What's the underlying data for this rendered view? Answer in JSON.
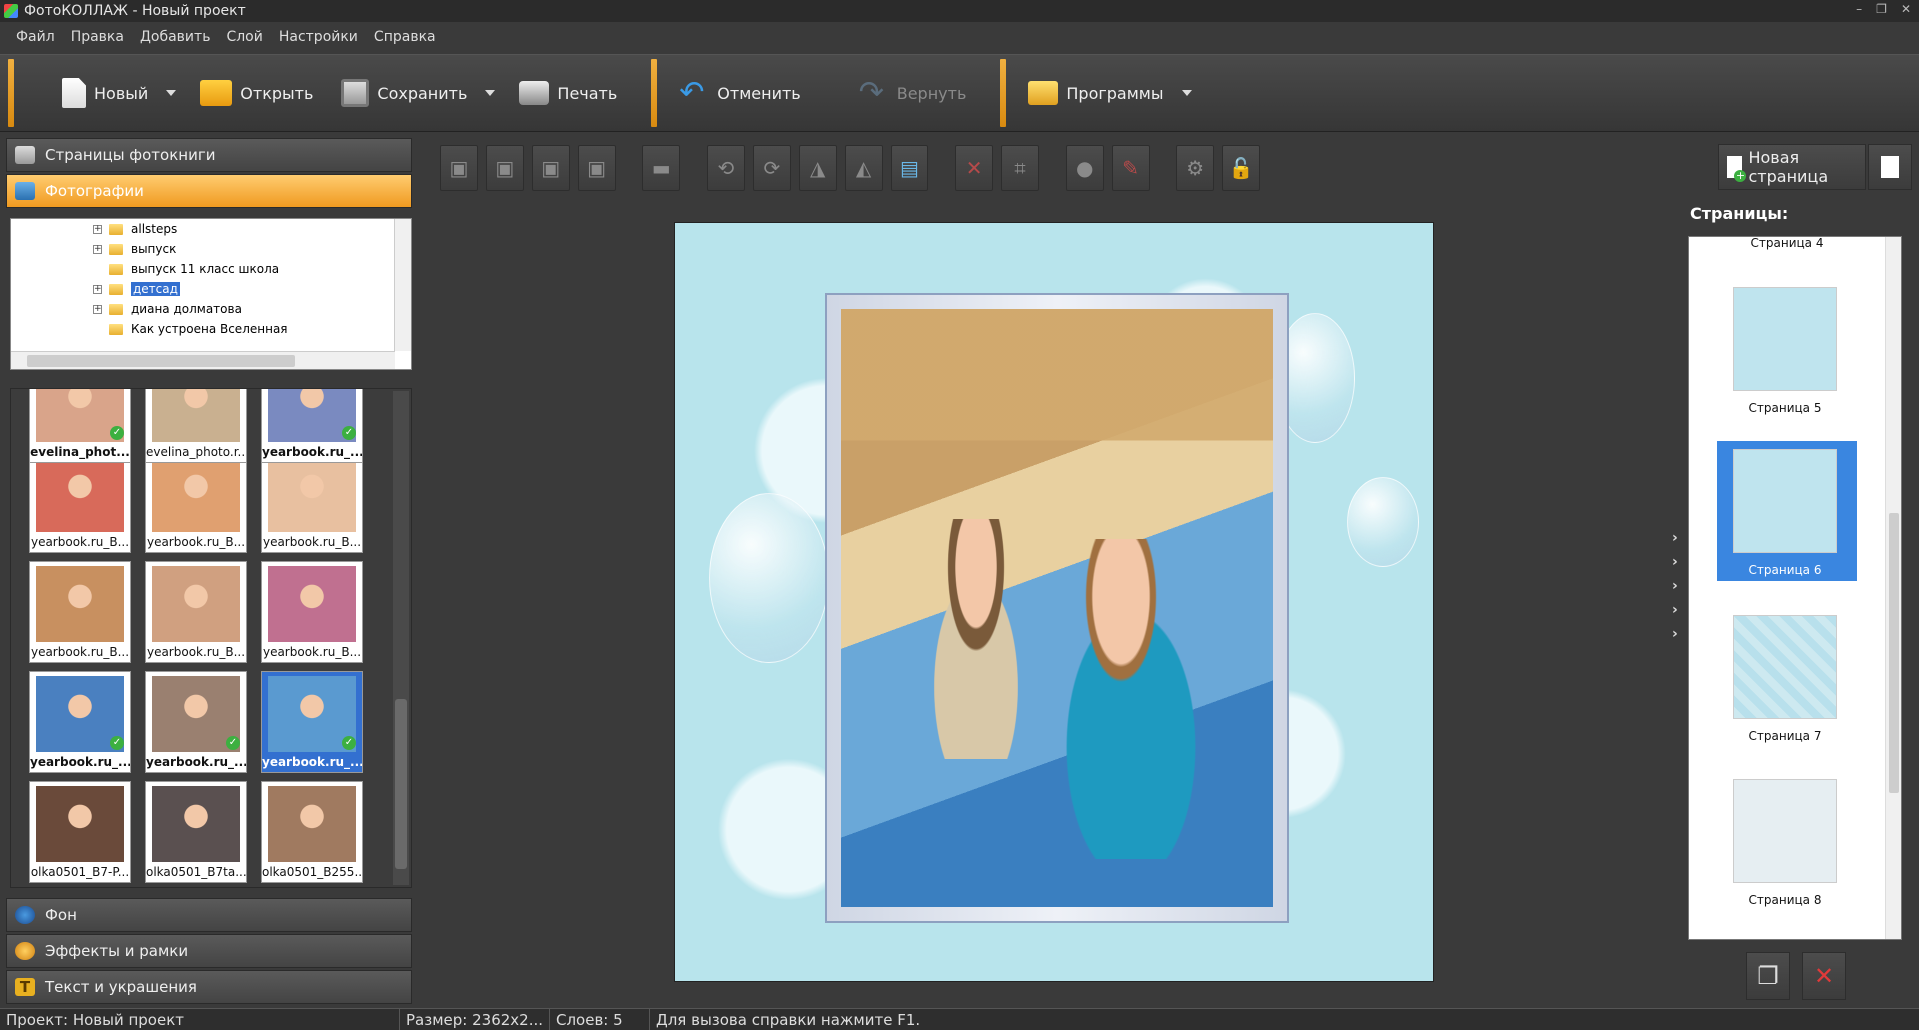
{
  "window": {
    "title": "ФотоКОЛЛАЖ - Новый проект"
  },
  "menu": [
    "Файл",
    "Правка",
    "Добавить",
    "Слой",
    "Настройки",
    "Справка"
  ],
  "toolbar": {
    "new_label": "Новый",
    "open_label": "Открыть",
    "save_label": "Сохранить",
    "print_label": "Печать",
    "undo_label": "Отменить",
    "redo_label": "Вернуть",
    "programs_label": "Программы"
  },
  "left_panel": {
    "book_pages": "Страницы фотокниги",
    "photos": "Фотографии",
    "background": "Фон",
    "effects": "Эффекты и рамки",
    "text": "Текст и украшения",
    "folders": [
      {
        "name": "allsteps",
        "expandable": true
      },
      {
        "name": "выпуск",
        "expandable": true
      },
      {
        "name": "выпуск 11 класс школа",
        "expandable": false
      },
      {
        "name": "детсад",
        "expandable": true,
        "selected": true
      },
      {
        "name": "диана долматова",
        "expandable": true
      },
      {
        "name": "Как устроена Вселенная",
        "expandable": false
      }
    ],
    "thumbnails": [
      {
        "caption": "evelina_phot...",
        "bold": true,
        "check": true,
        "color": "#d9a48a"
      },
      {
        "caption": "evelina_photo.r...",
        "bold": false,
        "check": false,
        "color": "#c9b090"
      },
      {
        "caption": "yearbook.ru_...",
        "bold": true,
        "check": true,
        "color": "#7a8ac0"
      },
      {
        "caption": "yearbook.ru_B...",
        "bold": false,
        "check": false,
        "color": "#d86a5a"
      },
      {
        "caption": "yearbook.ru_B...",
        "bold": false,
        "check": false,
        "color": "#e0a070"
      },
      {
        "caption": "yearbook.ru_B...",
        "bold": false,
        "check": false,
        "color": "#e8c0a0"
      },
      {
        "caption": "yearbook.ru_B...",
        "bold": false,
        "check": false,
        "color": "#c89060"
      },
      {
        "caption": "yearbook.ru_B...",
        "bold": false,
        "check": false,
        "color": "#d0a080"
      },
      {
        "caption": "yearbook.ru_B...",
        "bold": false,
        "check": false,
        "color": "#c07090"
      },
      {
        "caption": "yearbook.ru_...",
        "bold": true,
        "check": true,
        "color": "#4a80c0"
      },
      {
        "caption": "yearbook.ru_...",
        "bold": true,
        "check": true,
        "color": "#9a8070"
      },
      {
        "caption": "yearbook.ru_...",
        "bold": true,
        "check": true,
        "color": "#5a9ad0",
        "selected": true
      },
      {
        "caption": "olka0501_B7-P...",
        "bold": false,
        "check": false,
        "color": "#6a4a3a"
      },
      {
        "caption": "olka0501_B7ta...",
        "bold": false,
        "check": false,
        "color": "#5a5050"
      },
      {
        "caption": "olka0501_B255...",
        "bold": false,
        "check": false,
        "color": "#a07a60"
      }
    ]
  },
  "right_panel": {
    "new_page": "Новая страница",
    "pages_label": "Страницы:",
    "partial_page": "Страница 4",
    "pages": [
      {
        "caption": "Страница 5",
        "selected": false
      },
      {
        "caption": "Страница 6",
        "selected": true
      },
      {
        "caption": "Страница 7",
        "selected": false
      },
      {
        "caption": "Страница 8",
        "selected": false
      }
    ]
  },
  "status": {
    "project": "Проект:  Новый проект",
    "size": "Размер:  2362x2...",
    "layers": "Слоев:  5",
    "help": "Для вызова справки нажмите F1."
  }
}
